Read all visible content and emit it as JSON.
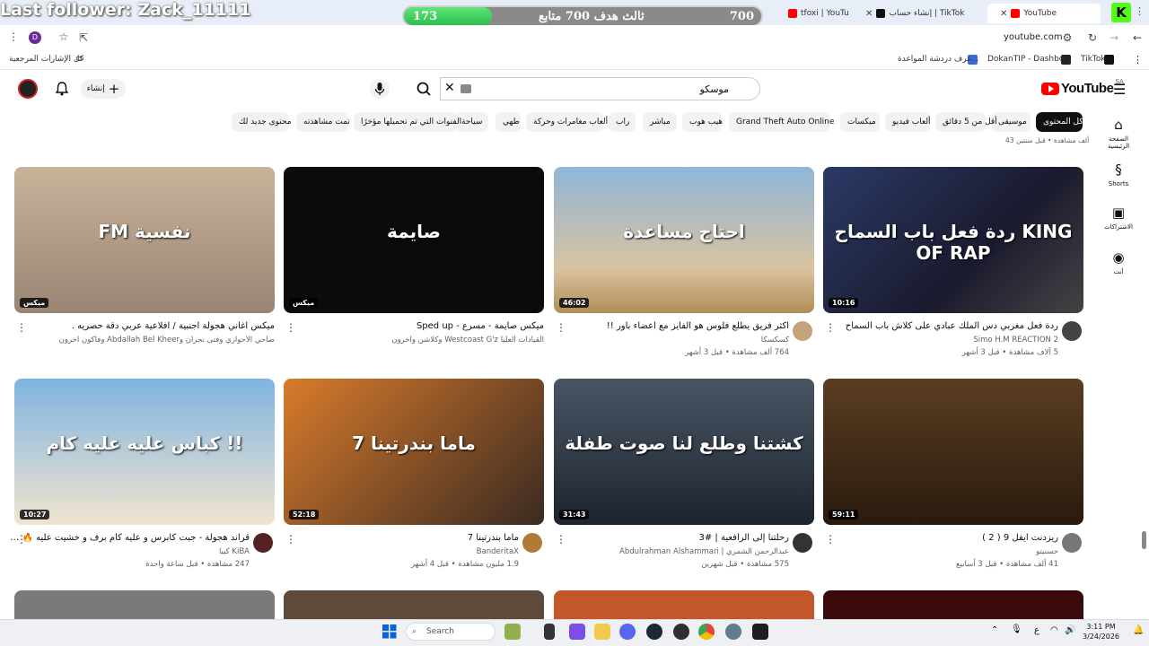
{
  "browser": {
    "tabs": [
      {
        "label": "YouTube",
        "active": true
      },
      {
        "label": "إنشاء حساب | TikTok"
      },
      {
        "label": "tfoxi | YouTube"
      }
    ],
    "url": "youtube.com",
    "profile_initial": "D",
    "bookmarks": [
      "TikTok",
      "DokanTIP - Dashbo...",
      "غرف دردشة المواعدة...",
      "كل الإشارات المرجعية"
    ]
  },
  "stream_overlay": {
    "last_follower": "Last follower: Zack_11111",
    "goal_current": "173",
    "goal_label": "ثالث هدف 700 متابع",
    "goal_target": "700",
    "goal_progress": 0.247
  },
  "youtube": {
    "logo_text": "YouTube",
    "country_code": "SA",
    "search_query": "موسكو",
    "create_label": "إنشاء",
    "chips": [
      "كل المحتوى",
      "موسيقى",
      "أقل من 5 دقائق",
      "ألعاب فيديو",
      "ميكسات",
      "Grand Theft Auto Online",
      "هيب هوب",
      "مباشر",
      "راب",
      "ألعاب مغامرات وحركة",
      "طهي",
      "سياحة",
      "الفنوات التي تم تحميلها مؤخرًا",
      "تمت مشاهدته",
      "محتوى جديد لك"
    ],
    "guide": [
      {
        "label": "الصفحة الرئيسية",
        "icon": "home-icon"
      },
      {
        "label": "Shorts",
        "icon": "shorts-icon"
      },
      {
        "label": "الاشتراكات",
        "icon": "subscriptions-icon"
      },
      {
        "label": "أنت",
        "icon": "you-icon"
      }
    ],
    "top_partial_meta": "43 ألف مشاهدة • قبل سنتين",
    "videos": [
      {
        "title": "ردة فعل مغربي دس الملك عبادي  على كلاش  باب السماح",
        "channel": "Simo H.M REACTION 2",
        "meta": "5 آلاف مشاهدة • قبل 3 أشهر",
        "duration": "10:16",
        "thumb_text": "ردة فعل باب السماح KING OF RAP"
      },
      {
        "title": "اكثر فريق يطلع فلوس هو الفايز مع اعضاء باور !!",
        "channel": "كسكسكا",
        "meta": "764 ألف مشاهدة • قبل 3 أشهر",
        "duration": "46:02",
        "thumb_text": "احتاج مساعدة"
      },
      {
        "title": "ميكس صايمة - مسرع - Sped up",
        "channel": "القيادات العليا Westcoast G'z وكلاشن وآخرون",
        "meta": "",
        "duration": "ميكس",
        "thumb_text": "صايمة"
      },
      {
        "title": "ميكس اغاني هجولة اجنبية / افلاعية عربي دقة حصريه .",
        "channel": "ضاحي الأحوازي وفتى نجران وAbdallah Bel Kheer وفاكون آخرون",
        "meta": "",
        "duration": "ميكس",
        "thumb_text": "FM نفسية"
      },
      {
        "title": "ريزدنت ايفل 9 ( 2 )",
        "channel": "حسنيتو",
        "meta": "41 ألف مشاهدة • قبل 3 أسابيع",
        "duration": "59:11",
        "thumb_text": ""
      },
      {
        "title": "رحلتنا إلى الرافعية | #3",
        "channel": "عبدالرحمن الشمري | Abdulrahman Alshammari",
        "meta": "575 مشاهدة • قبل شهرين",
        "duration": "31:43",
        "thumb_text": "كشتنا وطلع لنا صوت طفلة"
      },
      {
        "title": "ماما بندرتينا 7",
        "channel": "BanderitaX",
        "meta": "1.9 مليون مشاهدة • قبل 4 أشهر",
        "duration": "52:18",
        "thumb_text": "ماما بندرتينا 7"
      },
      {
        "title": "قراند هجولة - جبت كابرس و عليه كام برف و خشيت عليه 🔥 ✋",
        "channel": "KiBA كيبا",
        "meta": "247 مشاهدة • قبل ساعة واحدة",
        "duration": "10:27",
        "thumb_text": "كباس عليه عليه كام !!"
      }
    ]
  },
  "taskbar": {
    "search_placeholder": "Search",
    "time": "3:11 PM",
    "date": "3/24/2026",
    "lang": "ع"
  },
  "colors": {
    "accent": "#ff0000",
    "kick": "#53fc18",
    "goal_fill": "#2ebf4f"
  }
}
